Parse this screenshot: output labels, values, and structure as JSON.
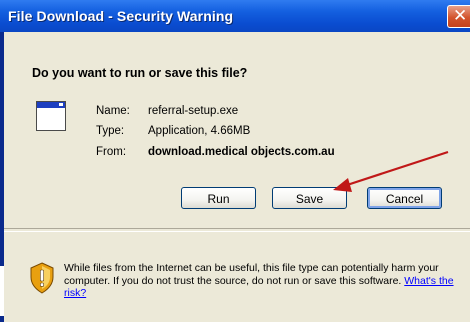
{
  "dialog": {
    "title": "File Download - Security Warning",
    "close_glyph": "✕",
    "question": "Do you want to run or save this file?",
    "file": {
      "name_label": "Name:",
      "name_value": "referral-setup.exe",
      "type_label": "Type:",
      "type_value": "Application, 4.66MB",
      "from_label": "From:",
      "from_value": "download.medical objects.com.au"
    },
    "buttons": {
      "run": "Run",
      "save": "Save",
      "cancel": "Cancel"
    },
    "warning": {
      "text": "While files from the Internet can be useful, this file type can potentially harm your computer. If you do not trust the source, do not run or save this software.",
      "link": "What's the risk?"
    },
    "icons": {
      "file": "application-file-icon",
      "warning": "security-shield-icon",
      "annotation": "red-arrow"
    },
    "colors": {
      "title_bar": "#0a4cd0",
      "dialog_bg": "#ece9d8",
      "close_button": "#d3542d",
      "arrow": "#c01818",
      "link": "#0000ff"
    }
  }
}
